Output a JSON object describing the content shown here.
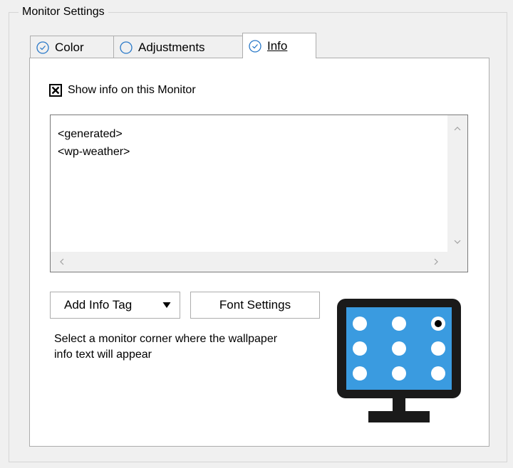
{
  "group": {
    "title": "Monitor Settings"
  },
  "tabs": [
    {
      "label": "Color",
      "icon": "check-circle-icon"
    },
    {
      "label": "Adjustments",
      "icon": "radio-empty-icon"
    },
    {
      "label": "Info",
      "icon": "check-circle-icon"
    }
  ],
  "selected_tab": "Info",
  "show_info": {
    "label": "Show info on this Monitor",
    "checked": true
  },
  "info_text": {
    "lines": [
      "<generated>",
      "<wp-weather>"
    ],
    "line1": "<generated>",
    "line2": "<wp-weather>"
  },
  "buttons": {
    "add_info_tag": "Add Info Tag",
    "font_settings": "Font Settings"
  },
  "help_text": "Select a monitor corner where the wallpaper info text will appear",
  "monitor_corners": {
    "selected": "top-right"
  },
  "colors": {
    "accent": "#2878c8",
    "screen": "#3a9be0",
    "bezel": "#1a1a1a"
  }
}
